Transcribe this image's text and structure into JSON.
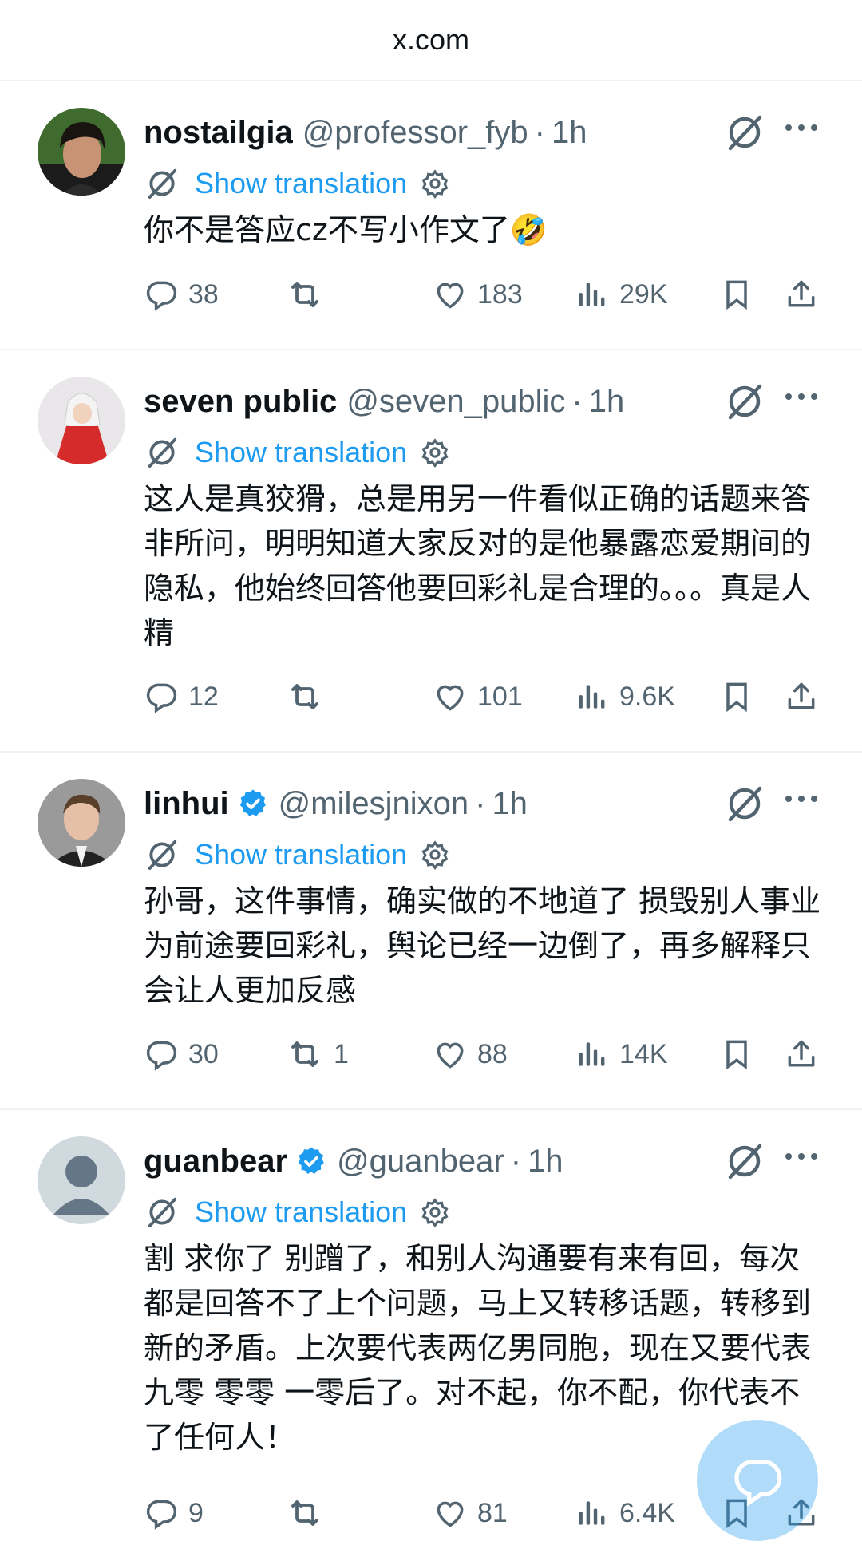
{
  "browser": {
    "url": "x.com"
  },
  "posts": [
    {
      "name": "nostailgia",
      "verified": false,
      "handle": "@professor_fyb",
      "dot": "·",
      "time": "1h",
      "translate_label": "Show translation",
      "text": "你不是答应cz不写小作文了🤣",
      "replies": "38",
      "reposts": "",
      "likes": "183",
      "views": "29K"
    },
    {
      "name": "seven public",
      "verified": false,
      "handle": "@seven_public",
      "dot": "·",
      "time": "1h",
      "translate_label": "Show translation",
      "text": "这人是真狡猾，总是用另一件看似正确的话题来答非所问，明明知道大家反对的是他暴露恋爱期间的隐私，他始终回答他要回彩礼是合理的。。。真是人精",
      "replies": "12",
      "reposts": "",
      "likes": "101",
      "views": "9.6K"
    },
    {
      "name": "linhui",
      "verified": true,
      "handle": "@milesjnixon",
      "dot": "·",
      "time": "1h",
      "translate_label": "Show translation",
      "text": "孙哥，这件事情，确实做的不地道了 损毁别人事业为前途要回彩礼，舆论已经一边倒了，再多解释只会让人更加反感",
      "replies": "30",
      "reposts": "1",
      "likes": "88",
      "views": "14K"
    },
    {
      "name": "guanbear",
      "verified": true,
      "handle": "@guanbear",
      "dot": "·",
      "time": "1h",
      "translate_label": "Show translation",
      "text": "割 求你了 别蹭了，和别人沟通要有来有回，每次都是回答不了上个问题，马上又转移话题，转移到新的矛盾。上次要代表两亿男同胞，现在又要代表九零 零零 一零后了。对不起，你不配，你代表不了任何人！",
      "replies": "9",
      "reposts": "",
      "likes": "81",
      "views": "6.4K"
    }
  ],
  "colors": {
    "accent": "#1d9bf0",
    "muted": "#536471",
    "text": "#0f1419",
    "divider": "#eff3f4"
  }
}
